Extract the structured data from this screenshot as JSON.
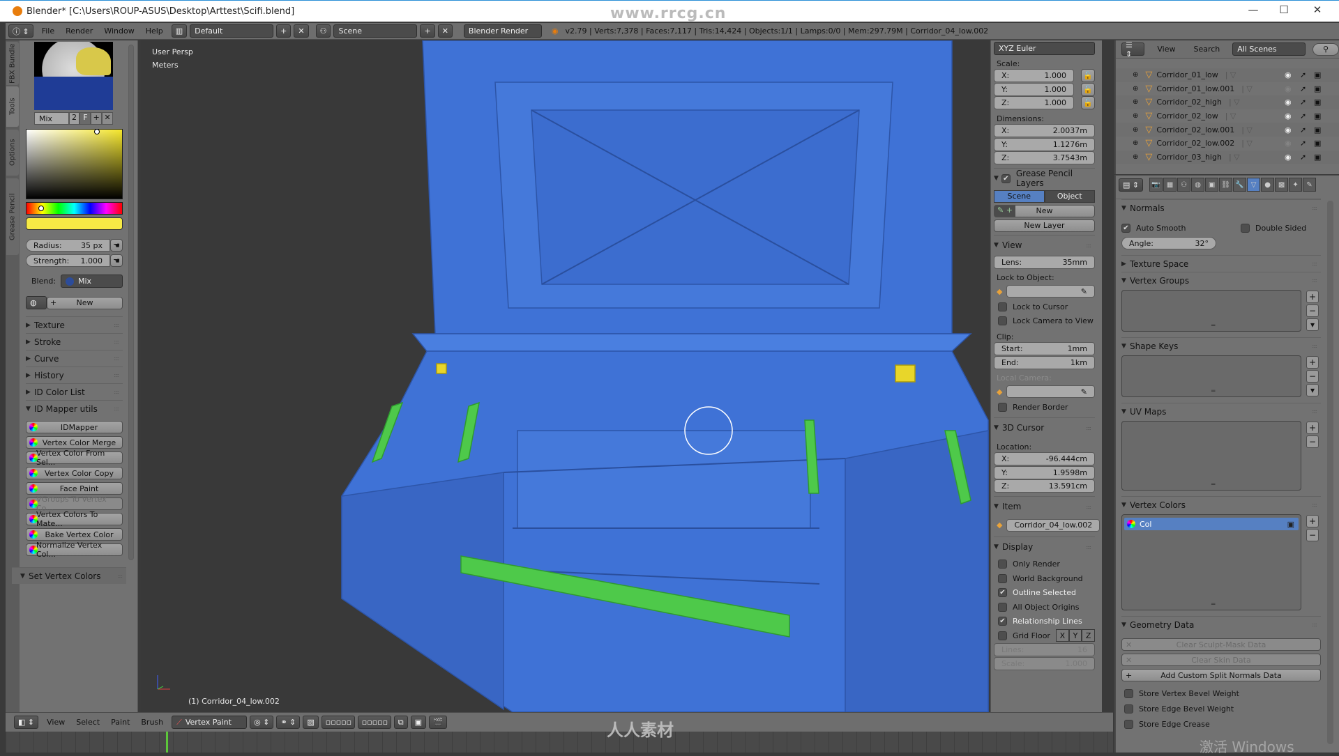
{
  "window": {
    "title": "Blender* [C:\\Users\\ROUP-ASUS\\Desktop\\Arttest\\Scifi.blend]",
    "watermark": "www.rrcg.cn",
    "minimize": "—",
    "maximize": "☐",
    "close": "✕"
  },
  "header": {
    "menus": [
      "File",
      "Render",
      "Window",
      "Help"
    ],
    "layout": "Default",
    "scene": "Scene",
    "engine": "Blender Render",
    "stats": "v2.79 | Verts:7,378 | Faces:7,117 | Tris:14,424 | Objects:1/1 | Lamps:0/0 | Mem:297.79M | Corridor_04_low.002"
  },
  "tabs": [
    {
      "label": "FBX Bundle",
      "active": false
    },
    {
      "label": "Tools",
      "active": true
    },
    {
      "label": "Options",
      "active": false
    },
    {
      "label": "Grease Pencil",
      "active": false
    }
  ],
  "toolshelf": {
    "brush_blend": "Mix",
    "brush_users": "2",
    "fake_user": "F",
    "color": "#f7ea45",
    "radius_label": "Radius:",
    "radius": "35 px",
    "strength_label": "Strength:",
    "strength": "1.000",
    "blend_label": "Blend:",
    "blend": "Mix",
    "new": "New",
    "panels": [
      "Texture",
      "Stroke",
      "Curve",
      "History",
      "ID Color List"
    ],
    "open_panel": "ID Mapper utils",
    "buttons": [
      {
        "label": "IDMapper",
        "enabled": true
      },
      {
        "label": "Vertex Color Merge",
        "enabled": true
      },
      {
        "label": "Vertex Color From Sel...",
        "enabled": true
      },
      {
        "label": "Vertex Color Copy",
        "enabled": true
      },
      {
        "label": "Face Paint",
        "enabled": true
      },
      {
        "label": "VGroups To Vertex Co...",
        "enabled": false
      },
      {
        "label": "Vertex Colors To Mate...",
        "enabled": true
      },
      {
        "label": "Bake Vertex Color",
        "enabled": true
      },
      {
        "label": "Normalize Vertex Col...",
        "enabled": true
      }
    ],
    "last_panel": "Set Vertex Colors"
  },
  "viewport": {
    "view_name": "User Persp",
    "units": "Meters",
    "object_label": "(1) Corridor_04_low.002",
    "model_color": "#3f72d6",
    "accent_green": "#4ec94a",
    "accent_yellow": "#e8d62a"
  },
  "npanel": {
    "rows": [
      {
        "type": "select",
        "label": "XYZ Euler"
      },
      {
        "type": "label",
        "label": "Scale:"
      },
      {
        "type": "field",
        "label": "X:",
        "value": "1.000",
        "lock": true
      },
      {
        "type": "field",
        "label": "Y:",
        "value": "1.000",
        "lock": true
      },
      {
        "type": "field",
        "label": "Z:",
        "value": "1.000",
        "lock": true
      },
      {
        "type": "label",
        "label": "Dimensions:"
      },
      {
        "type": "field",
        "label": "X:",
        "value": "2.0037m"
      },
      {
        "type": "field",
        "label": "Y:",
        "value": "1.1276m"
      },
      {
        "type": "field",
        "label": "Z:",
        "value": "3.7543m"
      },
      {
        "type": "section",
        "label": "Grease Pencil Layers",
        "checked": true
      },
      {
        "type": "toggle",
        "options": [
          "Scene",
          "Object"
        ],
        "active": 0
      },
      {
        "type": "button",
        "label": "New",
        "pencil": true
      },
      {
        "type": "button",
        "label": "New Layer"
      },
      {
        "type": "section",
        "label": "View"
      },
      {
        "type": "field",
        "label": "Lens:",
        "value": "35mm"
      },
      {
        "type": "label",
        "label": "Lock to Object:"
      },
      {
        "type": "object",
        "label": ""
      },
      {
        "type": "check",
        "label": "Lock to Cursor",
        "checked": false
      },
      {
        "type": "check",
        "label": "Lock Camera to View",
        "checked": false
      },
      {
        "type": "label",
        "label": "Clip:"
      },
      {
        "type": "field",
        "label": "Start:",
        "value": "1mm"
      },
      {
        "type": "field",
        "label": "End:",
        "value": "1km"
      },
      {
        "type": "label",
        "label": "Local Camera:",
        "dim": true
      },
      {
        "type": "object",
        "label": ""
      },
      {
        "type": "check",
        "label": "Render Border",
        "checked": false
      },
      {
        "type": "section",
        "label": "3D Cursor"
      },
      {
        "type": "label",
        "label": "Location:"
      },
      {
        "type": "field",
        "label": "X:",
        "value": "-96.444cm"
      },
      {
        "type": "field",
        "label": "Y:",
        "value": "1.9598m"
      },
      {
        "type": "field",
        "label": "Z:",
        "value": "13.591cm"
      },
      {
        "type": "section",
        "label": "Item"
      },
      {
        "type": "object",
        "label": "Corridor_04_low.002"
      },
      {
        "type": "section",
        "label": "Display"
      },
      {
        "type": "check",
        "label": "Only Render",
        "checked": false
      },
      {
        "type": "check",
        "label": "World Background",
        "checked": false
      },
      {
        "type": "check",
        "label": "Outline Selected",
        "checked": true
      },
      {
        "type": "check",
        "label": "All Object Origins",
        "checked": false
      },
      {
        "type": "check",
        "label": "Relationship Lines",
        "checked": true
      },
      {
        "type": "grid",
        "label": "Grid Floor",
        "checked": false,
        "axes": [
          "X",
          "Y",
          "Z"
        ]
      },
      {
        "type": "field",
        "label": "Lines:",
        "value": "16",
        "dim": true
      },
      {
        "type": "field",
        "label": "Scale:",
        "value": "1.000",
        "dim": true
      }
    ]
  },
  "outliner": {
    "menus": [
      "View",
      "Search"
    ],
    "filter": "All Scenes",
    "items": [
      {
        "name": "Corridor_01_low",
        "visible": true
      },
      {
        "name": "Corridor_01_low.001",
        "visible": false
      },
      {
        "name": "Corridor_02_high",
        "visible": true
      },
      {
        "name": "Corridor_02_low",
        "visible": true
      },
      {
        "name": "Corridor_02_low.001",
        "visible": true
      },
      {
        "name": "Corridor_02_low.002",
        "visible": false
      },
      {
        "name": "Corridor_03_high",
        "visible": true
      }
    ]
  },
  "properties": {
    "tabs": [
      "render",
      "render-layers",
      "scene",
      "world",
      "object",
      "constraints",
      "modifiers",
      "data",
      "material",
      "texture",
      "particles",
      "physics"
    ],
    "active_tab": "data",
    "normals": {
      "title": "Normals",
      "auto_smooth": "Auto Smooth",
      "auto_smooth_checked": true,
      "double_sided": "Double Sided",
      "double_sided_checked": false,
      "angle_label": "Angle:",
      "angle": "32°"
    },
    "texture_space": "Texture Space",
    "vertex_groups": "Vertex Groups",
    "shape_keys": "Shape Keys",
    "uv_maps": "UV Maps",
    "vertex_colors": {
      "title": "Vertex Colors",
      "items": [
        "Col"
      ]
    },
    "geometry": {
      "title": "Geometry Data",
      "clear_sculpt": "Clear Sculpt-Mask Data",
      "clear_skin": "Clear Skin Data",
      "add_normals": "Add Custom Split Normals Data",
      "checks": [
        "Store Vertex Bevel Weight",
        "Store Edge Bevel Weight",
        "Store Edge Crease"
      ]
    }
  },
  "bottom": {
    "menus": [
      "View",
      "Select",
      "Paint",
      "Brush"
    ],
    "mode": "Vertex Paint"
  },
  "watermarks": {
    "bottom": "人人素材",
    "activate": "激活 Windows"
  }
}
